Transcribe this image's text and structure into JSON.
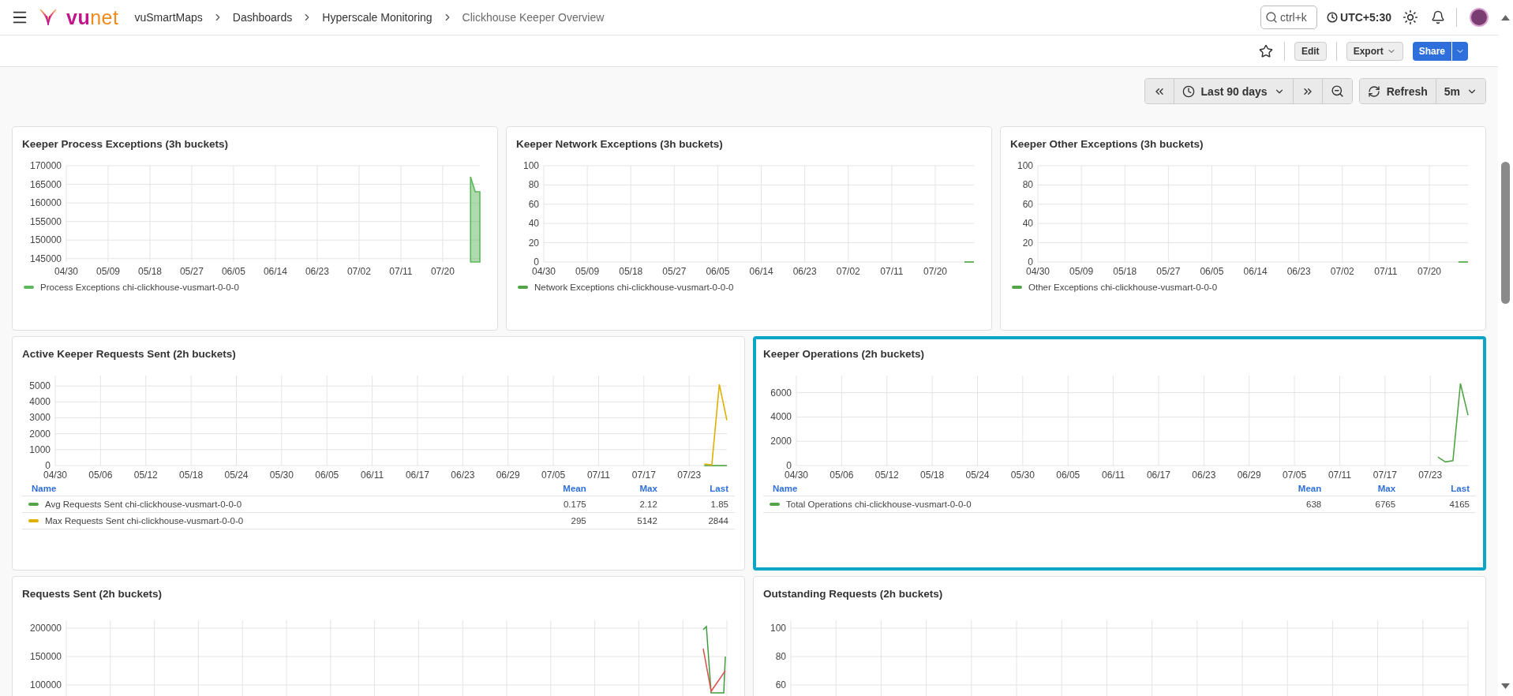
{
  "header": {
    "logo": [
      "vu",
      "net"
    ],
    "breadcrumbs": [
      {
        "label": "vuSmartMaps",
        "current": false
      },
      {
        "label": "Dashboards",
        "current": false
      },
      {
        "label": "Hyperscale Monitoring",
        "current": false
      },
      {
        "label": "Clickhouse Keeper Overview",
        "current": true
      }
    ],
    "search": {
      "placeholder": "ctrl+k"
    },
    "timezone": "UTC+5:30"
  },
  "toolbar": {
    "edit": "Edit",
    "export": "Export",
    "share": "Share"
  },
  "time_controls": {
    "range": "Last 90 days",
    "refresh": "Refresh",
    "interval": "5m"
  },
  "rows": [
    {
      "panels": [
        {
          "title": "Keeper Process Exceptions (3h buckets)",
          "highlighted": false,
          "chart_data": {
            "type": "area",
            "grid": true,
            "ylim": [
              144100,
              170000
            ],
            "yticks": [
              145000,
              150000,
              155000,
              160000,
              165000,
              170000
            ],
            "categories": [
              "04/30",
              null,
              null,
              null,
              null,
              null,
              null,
              null,
              null,
              "05/09",
              null,
              null,
              null,
              null,
              null,
              null,
              null,
              null,
              "05/18",
              null,
              null,
              null,
              null,
              null,
              null,
              null,
              null,
              "05/27",
              null,
              null,
              null,
              null,
              null,
              null,
              null,
              null,
              "06/05",
              null,
              null,
              null,
              null,
              null,
              null,
              null,
              null,
              "06/14",
              null,
              null,
              null,
              null,
              null,
              null,
              null,
              null,
              "06/23",
              null,
              null,
              null,
              null,
              null,
              null,
              null,
              null,
              "07/02",
              null,
              null,
              null,
              null,
              null,
              null,
              null,
              null,
              "07/11",
              null,
              null,
              null,
              null,
              null,
              null,
              null,
              null,
              "07/20",
              null,
              null,
              null,
              null,
              null,
              null,
              null,
              null
            ],
            "series": [
              {
                "name": "Process Exceptions chi-clickhouse-vusmart-0-0-0",
                "color": "#5cb85c",
                "values": [
                  null,
                  null,
                  null,
                  null,
                  null,
                  null,
                  null,
                  null,
                  null,
                  null,
                  null,
                  null,
                  null,
                  null,
                  null,
                  null,
                  null,
                  null,
                  null,
                  null,
                  null,
                  null,
                  null,
                  null,
                  null,
                  null,
                  null,
                  null,
                  null,
                  null,
                  null,
                  null,
                  null,
                  null,
                  null,
                  null,
                  null,
                  null,
                  null,
                  null,
                  null,
                  null,
                  null,
                  null,
                  null,
                  null,
                  null,
                  null,
                  null,
                  null,
                  null,
                  null,
                  null,
                  null,
                  null,
                  null,
                  null,
                  null,
                  null,
                  null,
                  null,
                  null,
                  null,
                  null,
                  null,
                  null,
                  null,
                  null,
                  null,
                  null,
                  null,
                  null,
                  null,
                  null,
                  null,
                  null,
                  null,
                  null,
                  null,
                  null,
                  null,
                  null,
                  null,
                  null,
                  null,
                  null,
                  null,
                  167000,
                  163000,
                  163000
                ]
              }
            ]
          }
        },
        {
          "title": "Keeper Network Exceptions (3h buckets)",
          "highlighted": false,
          "chart_data": {
            "type": "line",
            "grid": true,
            "ylim": [
              0,
              100
            ],
            "yticks": [
              0,
              20,
              40,
              60,
              80,
              100
            ],
            "categories": [
              "04/30",
              null,
              null,
              null,
              null,
              null,
              null,
              null,
              null,
              "05/09",
              null,
              null,
              null,
              null,
              null,
              null,
              null,
              null,
              "05/18",
              null,
              null,
              null,
              null,
              null,
              null,
              null,
              null,
              "05/27",
              null,
              null,
              null,
              null,
              null,
              null,
              null,
              null,
              "06/05",
              null,
              null,
              null,
              null,
              null,
              null,
              null,
              null,
              "06/14",
              null,
              null,
              null,
              null,
              null,
              null,
              null,
              null,
              "06/23",
              null,
              null,
              null,
              null,
              null,
              null,
              null,
              null,
              "07/02",
              null,
              null,
              null,
              null,
              null,
              null,
              null,
              null,
              "07/11",
              null,
              null,
              null,
              null,
              null,
              null,
              null,
              null,
              "07/20",
              null,
              null,
              null,
              null,
              null,
              null,
              null,
              null
            ],
            "series": [
              {
                "name": "Network Exceptions chi-clickhouse-vusmart-0-0-0",
                "color": "#52a447",
                "values": [
                  null,
                  null,
                  null,
                  null,
                  null,
                  null,
                  null,
                  null,
                  null,
                  null,
                  null,
                  null,
                  null,
                  null,
                  null,
                  null,
                  null,
                  null,
                  null,
                  null,
                  null,
                  null,
                  null,
                  null,
                  null,
                  null,
                  null,
                  null,
                  null,
                  null,
                  null,
                  null,
                  null,
                  null,
                  null,
                  null,
                  null,
                  null,
                  null,
                  null,
                  null,
                  null,
                  null,
                  null,
                  null,
                  null,
                  null,
                  null,
                  null,
                  null,
                  null,
                  null,
                  null,
                  null,
                  null,
                  null,
                  null,
                  null,
                  null,
                  null,
                  null,
                  null,
                  null,
                  null,
                  null,
                  null,
                  null,
                  null,
                  null,
                  null,
                  null,
                  null,
                  null,
                  null,
                  null,
                  null,
                  null,
                  null,
                  null,
                  null,
                  null,
                  null,
                  null,
                  null,
                  null,
                  null,
                  null,
                  0,
                  0,
                  0
                ]
              }
            ]
          }
        },
        {
          "title": "Keeper Other Exceptions (3h buckets)",
          "highlighted": false,
          "chart_data": {
            "type": "line",
            "grid": true,
            "ylim": [
              0,
              100
            ],
            "yticks": [
              0,
              20,
              40,
              60,
              80,
              100
            ],
            "categories": [
              "04/30",
              null,
              null,
              null,
              null,
              null,
              null,
              null,
              null,
              "05/09",
              null,
              null,
              null,
              null,
              null,
              null,
              null,
              null,
              "05/18",
              null,
              null,
              null,
              null,
              null,
              null,
              null,
              null,
              "05/27",
              null,
              null,
              null,
              null,
              null,
              null,
              null,
              null,
              "06/05",
              null,
              null,
              null,
              null,
              null,
              null,
              null,
              null,
              "06/14",
              null,
              null,
              null,
              null,
              null,
              null,
              null,
              null,
              "06/23",
              null,
              null,
              null,
              null,
              null,
              null,
              null,
              null,
              "07/02",
              null,
              null,
              null,
              null,
              null,
              null,
              null,
              null,
              "07/11",
              null,
              null,
              null,
              null,
              null,
              null,
              null,
              null,
              "07/20",
              null,
              null,
              null,
              null,
              null,
              null,
              null,
              null
            ],
            "series": [
              {
                "name": "Other Exceptions chi-clickhouse-vusmart-0-0-0",
                "color": "#52a447",
                "values": [
                  null,
                  null,
                  null,
                  null,
                  null,
                  null,
                  null,
                  null,
                  null,
                  null,
                  null,
                  null,
                  null,
                  null,
                  null,
                  null,
                  null,
                  null,
                  null,
                  null,
                  null,
                  null,
                  null,
                  null,
                  null,
                  null,
                  null,
                  null,
                  null,
                  null,
                  null,
                  null,
                  null,
                  null,
                  null,
                  null,
                  null,
                  null,
                  null,
                  null,
                  null,
                  null,
                  null,
                  null,
                  null,
                  null,
                  null,
                  null,
                  null,
                  null,
                  null,
                  null,
                  null,
                  null,
                  null,
                  null,
                  null,
                  null,
                  null,
                  null,
                  null,
                  null,
                  null,
                  null,
                  null,
                  null,
                  null,
                  null,
                  null,
                  null,
                  null,
                  null,
                  null,
                  null,
                  null,
                  null,
                  null,
                  null,
                  null,
                  null,
                  null,
                  null,
                  null,
                  null,
                  null,
                  null,
                  null,
                  0,
                  0,
                  0
                ]
              }
            ]
          }
        }
      ]
    },
    {
      "panels": [
        {
          "title": "Active Keeper Requests Sent (2h buckets)",
          "highlighted": false,
          "legend": {
            "name_heading": "Name",
            "columns": [
              "Mean",
              "Max",
              "Last"
            ],
            "rows": [
              [
                "0.175",
                "2.12",
                "1.85"
              ],
              [
                "295",
                "5142",
                "2844"
              ]
            ]
          },
          "chart_data": {
            "type": "line",
            "grid": true,
            "ylim": [
              0,
              5650
            ],
            "yticks": [
              0,
              1000,
              2000,
              3000,
              4000,
              5000
            ],
            "categories": [
              "04/30",
              null,
              null,
              null,
              null,
              null,
              "05/06",
              null,
              null,
              null,
              null,
              null,
              "05/12",
              null,
              null,
              null,
              null,
              null,
              "05/18",
              null,
              null,
              null,
              null,
              null,
              "05/24",
              null,
              null,
              null,
              null,
              null,
              "05/30",
              null,
              null,
              null,
              null,
              null,
              "06/05",
              null,
              null,
              null,
              null,
              null,
              "06/11",
              null,
              null,
              null,
              null,
              null,
              "06/17",
              null,
              null,
              null,
              null,
              null,
              "06/23",
              null,
              null,
              null,
              null,
              null,
              "06/29",
              null,
              null,
              null,
              null,
              null,
              "07/05",
              null,
              null,
              null,
              null,
              null,
              "07/11",
              null,
              null,
              null,
              null,
              null,
              "07/17",
              null,
              null,
              null,
              null,
              null,
              "07/23",
              null,
              null,
              null,
              null,
              null
            ],
            "series": [
              {
                "name": "Avg Requests Sent chi-clickhouse-vusmart-0-0-0",
                "color": "#52a447",
                "values": [
                  null,
                  null,
                  null,
                  null,
                  null,
                  null,
                  null,
                  null,
                  null,
                  null,
                  null,
                  null,
                  null,
                  null,
                  null,
                  null,
                  null,
                  null,
                  null,
                  null,
                  null,
                  null,
                  null,
                  null,
                  null,
                  null,
                  null,
                  null,
                  null,
                  null,
                  null,
                  null,
                  null,
                  null,
                  null,
                  null,
                  null,
                  null,
                  null,
                  null,
                  null,
                  null,
                  null,
                  null,
                  null,
                  null,
                  null,
                  null,
                  null,
                  null,
                  null,
                  null,
                  null,
                  null,
                  null,
                  null,
                  null,
                  null,
                  null,
                  null,
                  null,
                  null,
                  null,
                  null,
                  null,
                  null,
                  null,
                  null,
                  null,
                  null,
                  null,
                  null,
                  null,
                  null,
                  null,
                  null,
                  null,
                  null,
                  null,
                  null,
                  null,
                  null,
                  null,
                  null,
                  null,
                  null,
                  0,
                  0,
                  0,
                  0
                ]
              },
              {
                "name": "Max Requests Sent chi-clickhouse-vusmart-0-0-0",
                "color": "#e0b000",
                "values": [
                  null,
                  null,
                  null,
                  null,
                  null,
                  null,
                  null,
                  null,
                  null,
                  null,
                  null,
                  null,
                  null,
                  null,
                  null,
                  null,
                  null,
                  null,
                  null,
                  null,
                  null,
                  null,
                  null,
                  null,
                  null,
                  null,
                  null,
                  null,
                  null,
                  null,
                  null,
                  null,
                  null,
                  null,
                  null,
                  null,
                  null,
                  null,
                  null,
                  null,
                  null,
                  null,
                  null,
                  null,
                  null,
                  null,
                  null,
                  null,
                  null,
                  null,
                  null,
                  null,
                  null,
                  null,
                  null,
                  null,
                  null,
                  null,
                  null,
                  null,
                  null,
                  null,
                  null,
                  null,
                  null,
                  null,
                  null,
                  null,
                  null,
                  null,
                  null,
                  null,
                  null,
                  null,
                  null,
                  null,
                  null,
                  null,
                  null,
                  null,
                  null,
                  null,
                  null,
                  null,
                  null,
                  null,
                  100,
                  50,
                  5100,
                  2850
                ]
              }
            ]
          }
        },
        {
          "title": "Keeper Operations (2h buckets)",
          "highlighted": true,
          "legend": {
            "name_heading": "Name",
            "columns": [
              "Mean",
              "Max",
              "Last"
            ],
            "rows": [
              [
                "638",
                "6765",
                "4165"
              ]
            ]
          },
          "chart_data": {
            "type": "line",
            "grid": true,
            "ylim": [
              0,
              7400
            ],
            "yticks": [
              0,
              2000,
              4000,
              6000
            ],
            "categories": [
              "04/30",
              null,
              null,
              null,
              null,
              null,
              "05/06",
              null,
              null,
              null,
              null,
              null,
              "05/12",
              null,
              null,
              null,
              null,
              null,
              "05/18",
              null,
              null,
              null,
              null,
              null,
              "05/24",
              null,
              null,
              null,
              null,
              null,
              "05/30",
              null,
              null,
              null,
              null,
              null,
              "06/05",
              null,
              null,
              null,
              null,
              null,
              "06/11",
              null,
              null,
              null,
              null,
              null,
              "06/17",
              null,
              null,
              null,
              null,
              null,
              "06/23",
              null,
              null,
              null,
              null,
              null,
              "06/29",
              null,
              null,
              null,
              null,
              null,
              "07/05",
              null,
              null,
              null,
              null,
              null,
              "07/11",
              null,
              null,
              null,
              null,
              null,
              "07/17",
              null,
              null,
              null,
              null,
              null,
              "07/23",
              null,
              null,
              null,
              null,
              null
            ],
            "series": [
              {
                "name": "Total Operations chi-clickhouse-vusmart-0-0-0",
                "color": "#52a447",
                "values": [
                  null,
                  null,
                  null,
                  null,
                  null,
                  null,
                  null,
                  null,
                  null,
                  null,
                  null,
                  null,
                  null,
                  null,
                  null,
                  null,
                  null,
                  null,
                  null,
                  null,
                  null,
                  null,
                  null,
                  null,
                  null,
                  null,
                  null,
                  null,
                  null,
                  null,
                  null,
                  null,
                  null,
                  null,
                  null,
                  null,
                  null,
                  null,
                  null,
                  null,
                  null,
                  null,
                  null,
                  null,
                  null,
                  null,
                  null,
                  null,
                  null,
                  null,
                  null,
                  null,
                  null,
                  null,
                  null,
                  null,
                  null,
                  null,
                  null,
                  null,
                  null,
                  null,
                  null,
                  null,
                  null,
                  null,
                  null,
                  null,
                  null,
                  null,
                  null,
                  null,
                  null,
                  null,
                  null,
                  null,
                  null,
                  null,
                  null,
                  null,
                  null,
                  null,
                  null,
                  null,
                  null,
                  700,
                  300,
                  400,
                  6750,
                  4150
                ]
              }
            ]
          }
        }
      ]
    },
    {
      "panels": [
        {
          "title": "Requests Sent (2h buckets)",
          "highlighted": false,
          "y_labels": [
            "200000",
            "150000",
            "100000"
          ],
          "trace": true
        },
        {
          "title": "Outstanding Requests (2h buckets)",
          "highlighted": false,
          "y_labels": [
            "100",
            "80",
            "60"
          ]
        }
      ]
    }
  ]
}
